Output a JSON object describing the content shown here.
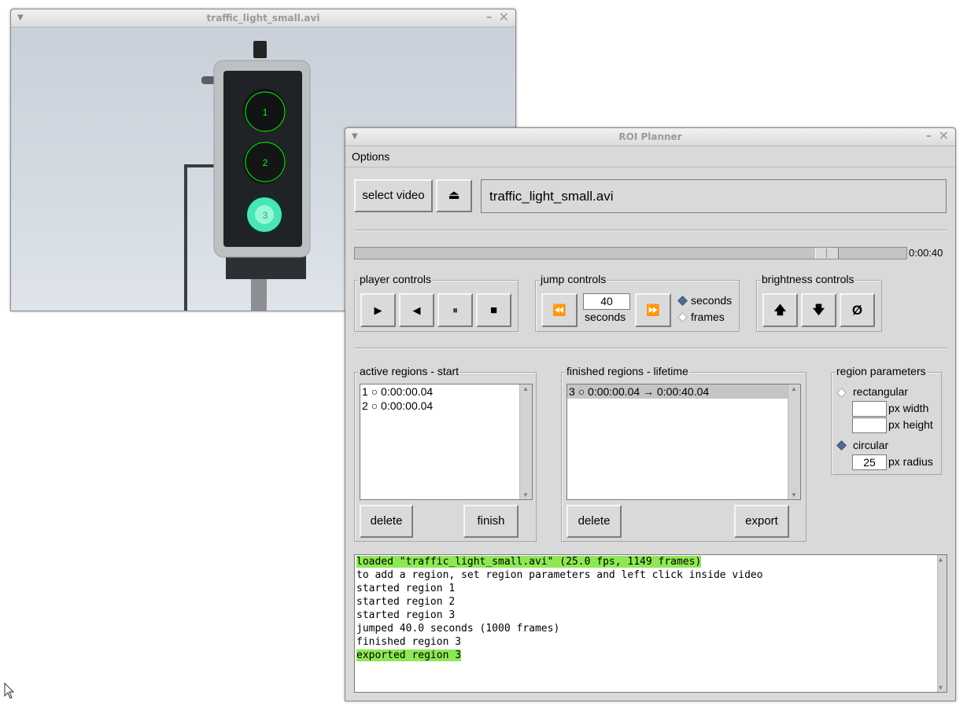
{
  "video_window": {
    "title": "traffic_light_small.avi",
    "regions": [
      {
        "label": "1"
      },
      {
        "label": "2"
      },
      {
        "label": "3"
      }
    ]
  },
  "planner": {
    "title": "ROI Planner",
    "menu": {
      "options": "Options"
    },
    "select_video_label": "select video",
    "eject_icon": "⏏",
    "file_name": "traffic_light_small.avi",
    "time_label": "0:00:40",
    "player_controls": {
      "title": "player controls",
      "play": "▶",
      "back": "◀",
      "pause": "⏸",
      "stop": "■"
    },
    "jump_controls": {
      "title": "jump controls",
      "rewind": "⏪",
      "forward": "⏩",
      "amount": "40",
      "unit_label": "seconds",
      "mode_seconds": "seconds",
      "mode_frames": "frames",
      "selected_mode": "seconds"
    },
    "brightness_controls": {
      "title": "brightness controls",
      "up": "🡅",
      "down": "🡇",
      "reset": "Ø"
    },
    "active_regions": {
      "title": "active regions - start",
      "items": [
        {
          "id": "1",
          "shape": "○",
          "time": "0:00:00.04"
        },
        {
          "id": "2",
          "shape": "○",
          "time": "0:00:00.04"
        }
      ],
      "delete_label": "delete",
      "finish_label": "finish"
    },
    "finished_regions": {
      "title": "finished regions - lifetime",
      "items": [
        {
          "id": "3",
          "shape": "○",
          "time": "0:00:00.04 → 0:00:40.04"
        }
      ],
      "delete_label": "delete",
      "export_label": "export"
    },
    "region_parameters": {
      "title": "region parameters",
      "rectangular_label": "rectangular",
      "width_value": "",
      "width_label": "px width",
      "height_value": "",
      "height_label": "px height",
      "circular_label": "circular",
      "radius_value": "25",
      "radius_label": "px radius",
      "selected_shape": "circular"
    },
    "log": [
      {
        "text": "loaded \"traffic_light_small.avi\" (25.0 fps, 1149 frames)",
        "highlight": true
      },
      {
        "text": "to add a region, set region parameters and left click inside video",
        "highlight": false
      },
      {
        "text": "started region 1",
        "highlight": false
      },
      {
        "text": "started region 2",
        "highlight": false
      },
      {
        "text": "started region 3",
        "highlight": false
      },
      {
        "text": "jumped 40.0 seconds (1000 frames)",
        "highlight": false
      },
      {
        "text": "finished region 3",
        "highlight": false
      },
      {
        "text": "exported region 3",
        "highlight": true
      }
    ],
    "colors": {
      "log_highlight": "#8ee855",
      "region_circle": "#00ff00",
      "radio_selected": "#4f6d8f"
    }
  }
}
